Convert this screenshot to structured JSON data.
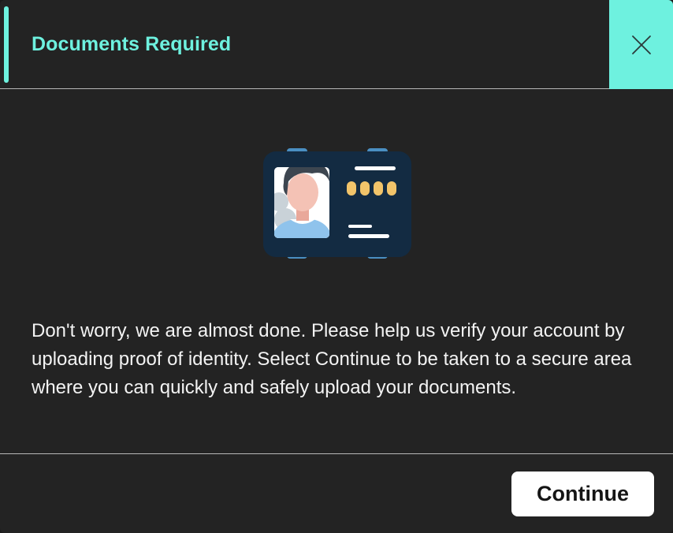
{
  "modal": {
    "title": "Documents Required",
    "close_icon": "close-icon",
    "illustration_icon": "id-card-icon",
    "message": "Don't worry, we are almost done. Please help us verify your account by uploading proof of identity. Select Continue to be taken to a secure area where you can quickly and safely upload your documents.",
    "continue_label": "Continue"
  },
  "colors": {
    "accent": "#6ef1df",
    "background": "#232323",
    "text": "#f3f3f3",
    "card": "#132b42",
    "card_dots": "#f2c46a"
  }
}
